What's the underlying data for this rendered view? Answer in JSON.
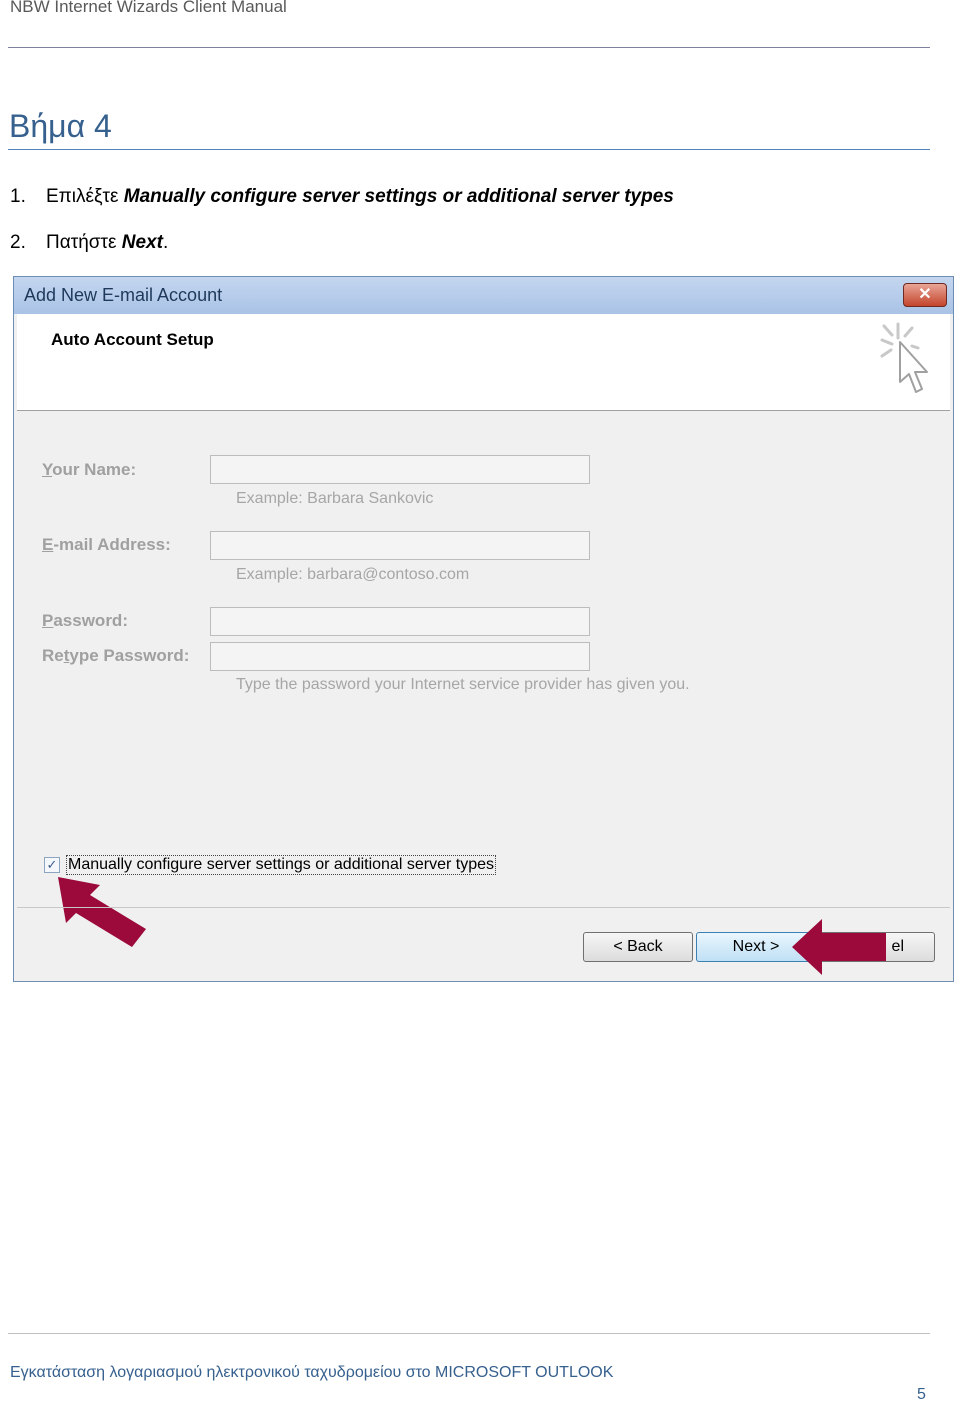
{
  "header": {
    "title": "NBW Internet Wizards Client Manual"
  },
  "step": {
    "title": "Βήμα 4"
  },
  "instructions": [
    {
      "num": "1.",
      "text": "Επιλέξτε ",
      "bold": "Manually configure server settings or additional server types",
      "after": ""
    },
    {
      "num": "2.",
      "text": "Πατήστε ",
      "bold": "Next",
      "after": "."
    }
  ],
  "dialog": {
    "title": "Add New E-mail Account",
    "close_label": "✕",
    "section_title": "Auto Account Setup",
    "fields": {
      "name_label_u": "Y",
      "name_label_rest": "our Name:",
      "name_value": "",
      "name_hint": "Example: Barbara Sankovic",
      "email_label_u": "E",
      "email_label_rest": "-mail Address:",
      "email_value": "",
      "email_hint": "Example: barbara@contoso.com",
      "password_label_u": "P",
      "password_label_rest": "assword:",
      "password_value": "",
      "retype_label_pre": "Re",
      "retype_label_u": "t",
      "retype_label_rest": "ype Password:",
      "retype_value": "",
      "password_hint": "Type the password your Internet service provider has given you."
    },
    "checkbox": {
      "checked": true,
      "label": "Manually configure server settings or additional server types"
    },
    "buttons": {
      "back": "< Back",
      "next": "Next >",
      "cancel_visible": "el"
    },
    "colors": {
      "arrow": "#9b0a3a"
    }
  },
  "footer": {
    "text": "Εγκατάσταση λογαριασμού ηλεκτρονικού ταχυδρομείου στο MICROSOFT OUTLOOK",
    "page": "5"
  }
}
